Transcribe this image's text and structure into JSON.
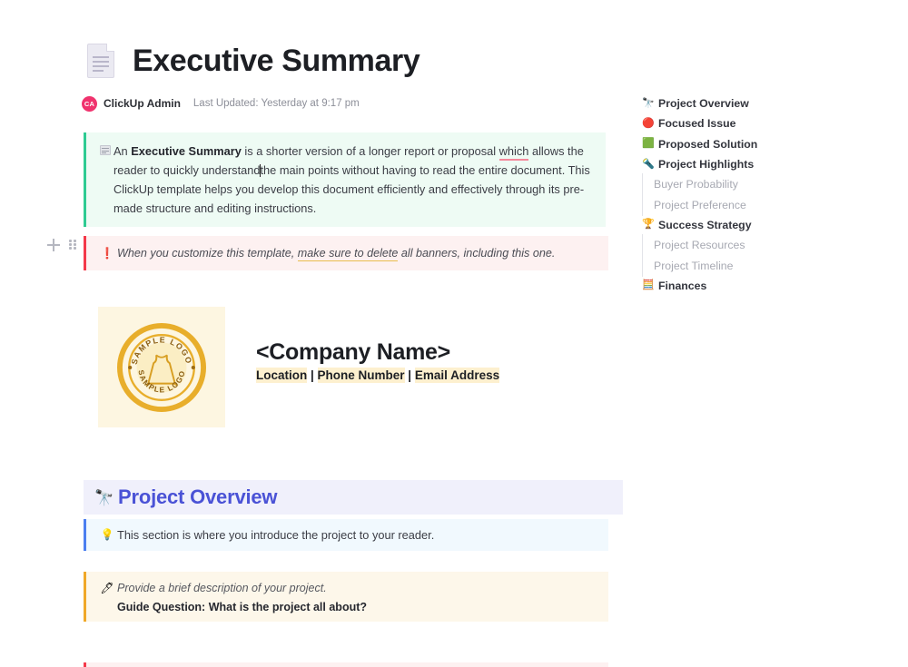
{
  "document": {
    "icon": "document-page-icon",
    "title": "Executive Summary",
    "author_initials": "CA",
    "author": "ClickUp Admin",
    "last_updated": "Last Updated: Yesterday at 9:17 pm"
  },
  "gutter": {
    "add_icon": "plus-icon",
    "drag_icon": "drag-handle-icon"
  },
  "green_banner": {
    "icon": "note-card-icon",
    "accent": "#2ecb92",
    "background": "#eefbf4",
    "text_1": "An ",
    "bold_1": "Executive Summary",
    "text_2": " is a shorter version of a longer report or proposal ",
    "underlined": "which",
    "text_3": " allows the reader to quickly understand",
    "text_4": "the main points without having to read the entire document. This ClickUp template helps you develop this document efficiently and effectively through its pre-made structure and editing instructions."
  },
  "pink_banner": {
    "icon": "exclamation-icon",
    "icon_glyph": "❗",
    "accent": "#f4394a",
    "background": "#fdf1f1",
    "text_1": "When you customize this template, ",
    "underlined": "make sure to delete",
    "text_2": " all banners, including this one."
  },
  "logo": {
    "name": "sample-logo-badge",
    "top_text": "SAMPLE LOGO",
    "bottom_text": "SAMPLE LOGO",
    "background": "#fdf6e1",
    "gold": "#e2a827",
    "gold_light": "#f4c23f"
  },
  "company": {
    "name": "<Company Name>",
    "location": "Location",
    "sep_1": " | ",
    "phone": "Phone Number",
    "sep_2": " | ",
    "email": "Email Address",
    "highlight": "#fdf0cf"
  },
  "section": {
    "icon": "telescope-icon",
    "icon_glyph": "🔭",
    "heading": "Project Overview",
    "heading_color": "#4a52d6",
    "background": "#f0f0fb"
  },
  "blue_banner": {
    "icon": "lightbulb-icon",
    "icon_glyph": "💡",
    "accent": "#4c7ff0",
    "background": "#f1f9fe",
    "text": "This section is where you introduce the project to your reader."
  },
  "yellow_banner": {
    "icon": "pen-icon",
    "icon_glyph": "🖊",
    "accent": "#f0a828",
    "background": "#fdf7ea",
    "line_1": "Provide a brief description of your project.",
    "line_2": "Guide Question: What is the project all about?"
  },
  "toc": {
    "items": [
      {
        "label": "Project Overview",
        "icon": "telescope-icon",
        "glyph": "🔭",
        "sub": false
      },
      {
        "label": "Focused Issue",
        "icon": "red-circle-icon",
        "glyph": "🔴",
        "sub": false
      },
      {
        "label": "Proposed Solution",
        "icon": "green-square-icon",
        "glyph": "🟩",
        "sub": false
      },
      {
        "label": "Project Highlights",
        "icon": "flashlight-icon",
        "glyph": "🔦",
        "sub": false
      },
      {
        "label": "Buyer Probability",
        "icon": "",
        "glyph": "",
        "sub": true
      },
      {
        "label": "Project Preference",
        "icon": "",
        "glyph": "",
        "sub": true
      },
      {
        "label": "Success Strategy",
        "icon": "trophy-icon",
        "glyph": "🏆",
        "sub": false
      },
      {
        "label": "Project Resources",
        "icon": "",
        "glyph": "",
        "sub": true
      },
      {
        "label": "Project Timeline",
        "icon": "",
        "glyph": "",
        "sub": true
      },
      {
        "label": "Finances",
        "icon": "abacus-icon",
        "glyph": "🧮",
        "sub": false
      }
    ]
  }
}
